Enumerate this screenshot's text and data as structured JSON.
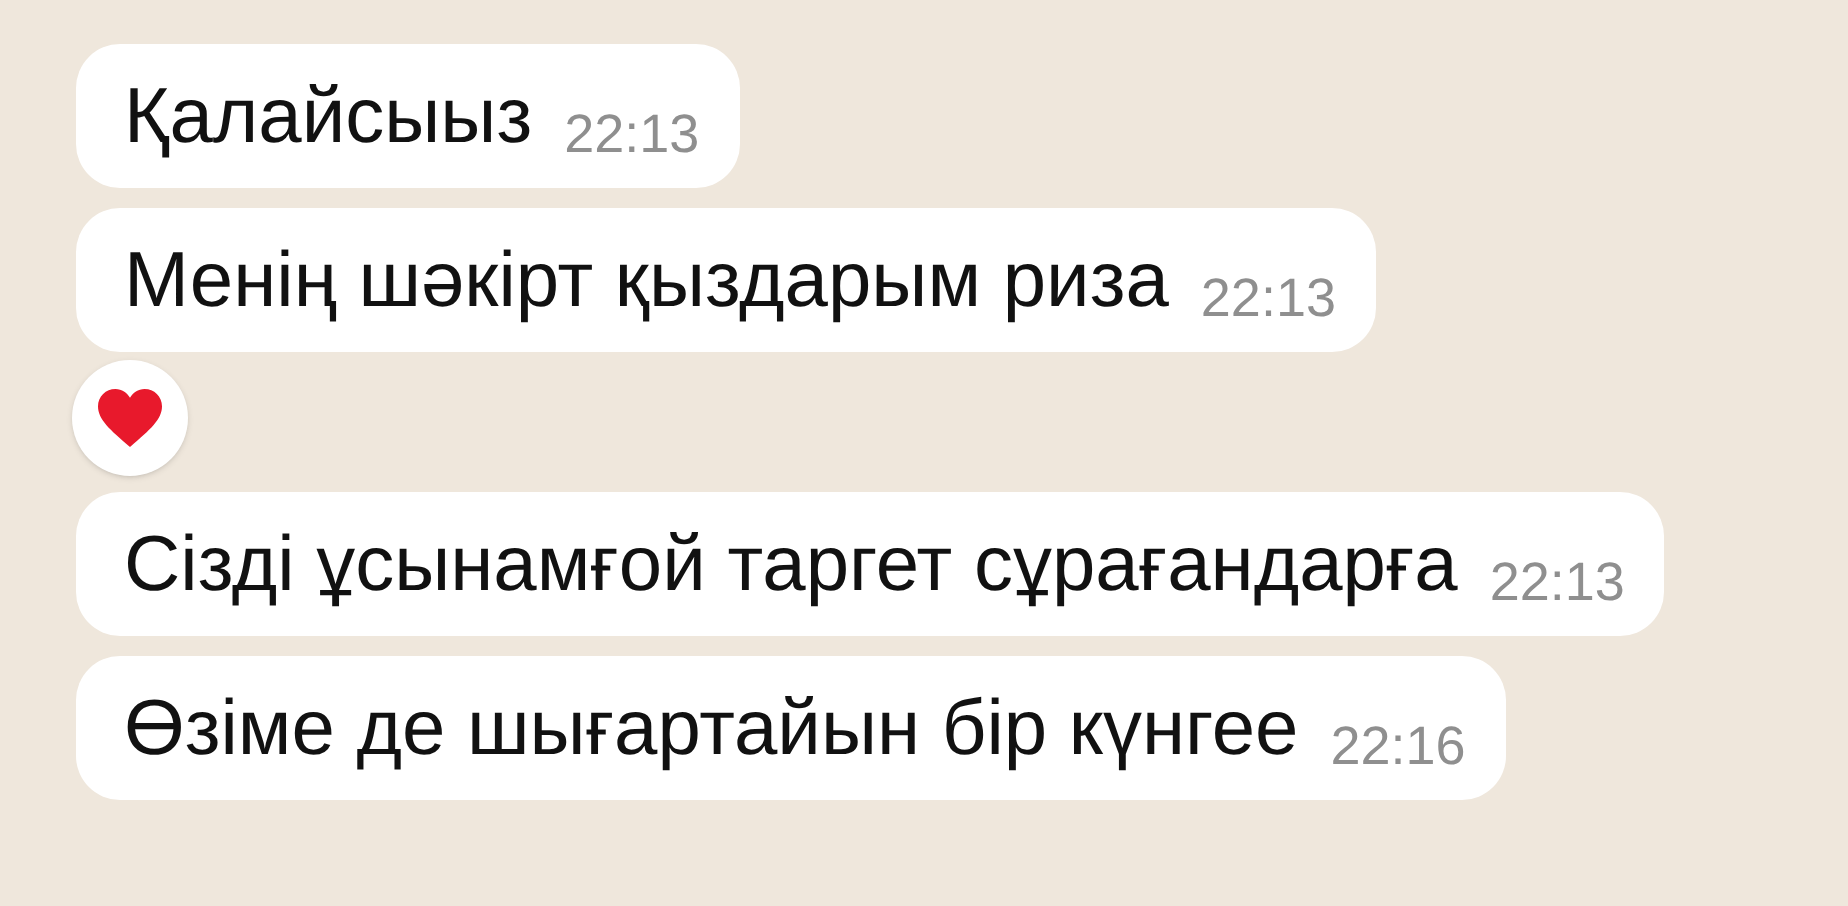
{
  "messages": [
    {
      "text": "Қалайсыыз",
      "time": "22:13",
      "reacted": false
    },
    {
      "text": "Менің шәкірт қыздарым риза",
      "time": "22:13",
      "reacted": true
    },
    {
      "text": "Сізді ұсынамғой таргет сұрағандарға",
      "time": "22:13",
      "reacted": false
    },
    {
      "text": "Өзіме де шығартайын бір күнгее",
      "time": "22:16",
      "reacted": false
    }
  ]
}
